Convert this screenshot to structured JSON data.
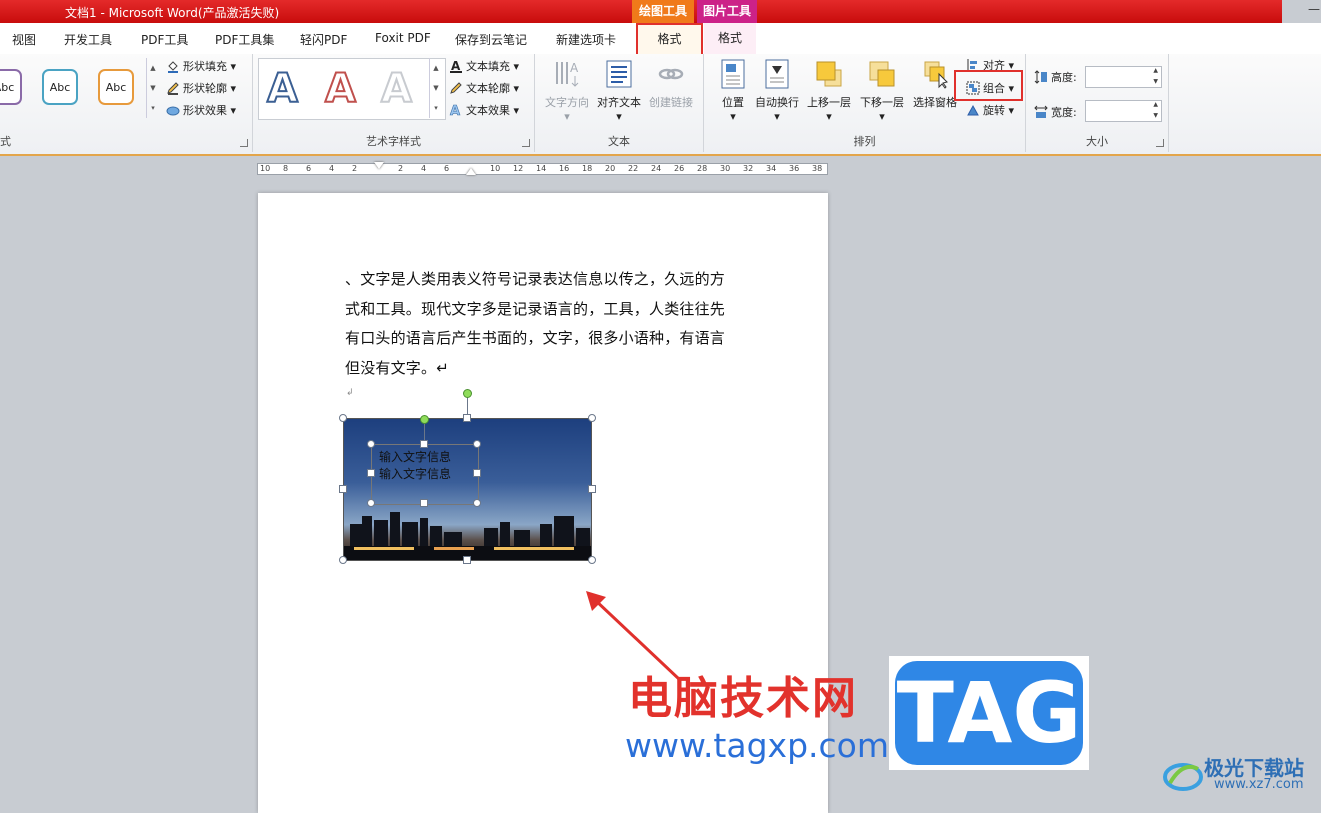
{
  "window": {
    "title": "文档1 - Microsoft Word(产品激活失败)",
    "minimize_glyph": "—"
  },
  "context_tabs": {
    "drawing_tools": "绘图工具",
    "picture_tools": "图片工具"
  },
  "tabs": [
    "视图",
    "开发工具",
    "PDF工具",
    "PDF工具集",
    "轻闪PDF",
    "Foxit PDF",
    "保存到云笔记",
    "新建选项卡",
    "格式",
    "格式"
  ],
  "ribbon": {
    "shape_styles": {
      "label": "式",
      "swatch_text": "Abc",
      "fill": "形状填充",
      "outline": "形状轮廓",
      "effects": "形状效果"
    },
    "wordart": {
      "label": "艺术字样式",
      "letter": "A",
      "text_fill": "文本填充",
      "text_outline": "文本轮廓",
      "text_effects": "文本效果"
    },
    "text": {
      "label": "文本",
      "direction": "文字方向",
      "align": "对齐文本",
      "link": "创建链接"
    },
    "arrange": {
      "label": "排列",
      "position": "位置",
      "wrap": "自动换行",
      "forward": "上移一层",
      "backward": "下移一层",
      "pane": "选择窗格",
      "align": "对齐",
      "group": "组合",
      "rotate": "旋转"
    },
    "size": {
      "label": "大小",
      "height": "高度:",
      "width": "宽度:"
    }
  },
  "ruler": [
    "10",
    "8",
    "6",
    "4",
    "2",
    "",
    "2",
    "4",
    "6",
    "",
    "10",
    "12",
    "14",
    "16",
    "18",
    "20",
    "22",
    "24",
    "26",
    "28",
    "30",
    "32",
    "34",
    "36",
    "38"
  ],
  "document": {
    "paragraph": "、文字是人类用表义符号记录表达信息以传之，久远的方式和工具。现代文字多是记录语言的，工具，人类往往先有口头的语言后产生书面的，文字，很多小语种，有语言但没有文字。↵",
    "textbox_lines": [
      "输入文字信息",
      "输入文字信息"
    ]
  },
  "watermark": {
    "cn": "电脑技术网",
    "url": "www.tagxp.com",
    "tag": "TAG",
    "site_cn": "极光下载站",
    "site_url": "www.xz7.com"
  },
  "colors": {
    "titlebar": "#d81818",
    "drawing_tools": "#f07a1a",
    "picture_tools": "#cc2288",
    "highlight": "#e0302c",
    "watermark_red": "#e2322c",
    "watermark_blue": "#2a6fd8"
  }
}
